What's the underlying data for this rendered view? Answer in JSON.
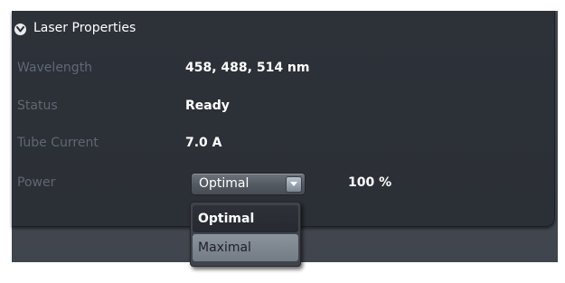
{
  "panel": {
    "title": "Laser Properties",
    "collapse_icon": "chevron-down-circle-icon"
  },
  "rows": [
    {
      "label": "Wavelength",
      "value": "458, 488, 514 nm"
    },
    {
      "label": "Status",
      "value": "Ready"
    },
    {
      "label": "Tube Current",
      "value": "7.0 A"
    }
  ],
  "power": {
    "label": "Power",
    "selected": "Optimal",
    "percent": "100 %",
    "options": [
      "Optimal",
      "Maximal"
    ]
  },
  "colors": {
    "panel_bg": "#2b2f36",
    "outer_bg": "#454a52",
    "label_text": "#5f6873",
    "value_text": "#ffffff"
  }
}
